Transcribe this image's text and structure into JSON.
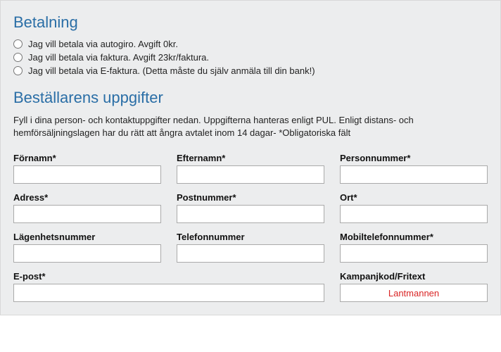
{
  "payment": {
    "heading": "Betalning",
    "options": {
      "autogiro": "Jag vill betala via autogiro. Avgift 0kr.",
      "faktura": "Jag vill betala via faktura. Avgift 23kr/faktura.",
      "efaktura": "Jag vill betala via E-faktura. (Detta måste du själv anmäla till din bank!)"
    }
  },
  "orderer": {
    "heading": "Beställarens uppgifter",
    "description": "Fyll i dina person- och kontaktuppgifter nedan. Uppgifterna hanteras enligt PUL. Enligt distans- och hemförsäljningslagen har du rätt att ångra avtalet inom 14 dagar- *Obligatoriska fält"
  },
  "fields": {
    "fornamn": {
      "label": "Förnamn*",
      "value": ""
    },
    "efternamn": {
      "label": "Efternamn*",
      "value": ""
    },
    "personnummer": {
      "label": "Personnummer*",
      "value": ""
    },
    "adress": {
      "label": "Adress*",
      "value": ""
    },
    "postnummer": {
      "label": "Postnummer*",
      "value": ""
    },
    "ort": {
      "label": "Ort*",
      "value": ""
    },
    "lagenhetsnummer": {
      "label": "Lägenhetsnummer",
      "value": ""
    },
    "telefonnummer": {
      "label": "Telefonnummer",
      "value": ""
    },
    "mobiltelefonnummer": {
      "label": "Mobiltelefonnummer*",
      "value": ""
    },
    "epost": {
      "label": "E-post*",
      "value": ""
    },
    "kampanjkod": {
      "label": "Kampanjkod/Fritext",
      "value": "Lantmannen"
    }
  }
}
